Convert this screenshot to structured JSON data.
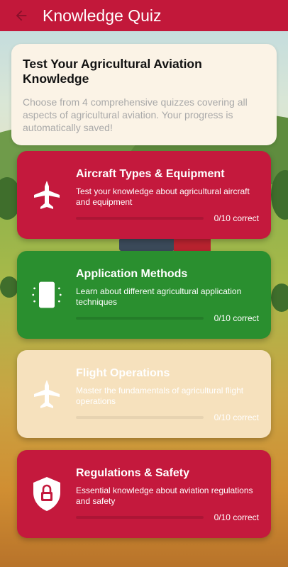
{
  "appbar": {
    "title": "Knowledge Quiz",
    "back_icon": "arrow-left-icon",
    "color": "#c2183a"
  },
  "intro": {
    "title": "Test Your Agricultural Aviation Knowledge",
    "description": "Choose from 4 comprehensive quizzes covering all aspects of agricultural aviation. Your progress is automatically saved!"
  },
  "quizzes": [
    {
      "title": "Aircraft Types & Equipment",
      "description": "Test your knowledge about agricultural aircraft and equipment",
      "progress": "0/10 correct",
      "progress_fraction": 0,
      "icon": "airplane-icon",
      "color": "#c4193d"
    },
    {
      "title": "Application Methods",
      "description": "Learn about different agricultural application techniques",
      "progress": "0/10 correct",
      "progress_fraction": 0,
      "icon": "spray-icon",
      "color": "#2a8f2f"
    },
    {
      "title": "Flight Operations",
      "description": "Master the fundamentals of agricultural flight operations",
      "progress": "0/10 correct",
      "progress_fraction": 0,
      "icon": "airplane-icon",
      "color": "#f6e1bd"
    },
    {
      "title": "Regulations & Safety",
      "description": "Essential knowledge about aviation regulations and safety",
      "progress": "0/10 correct",
      "progress_fraction": 0,
      "icon": "shield-lock-icon",
      "color": "#c4193d"
    }
  ]
}
